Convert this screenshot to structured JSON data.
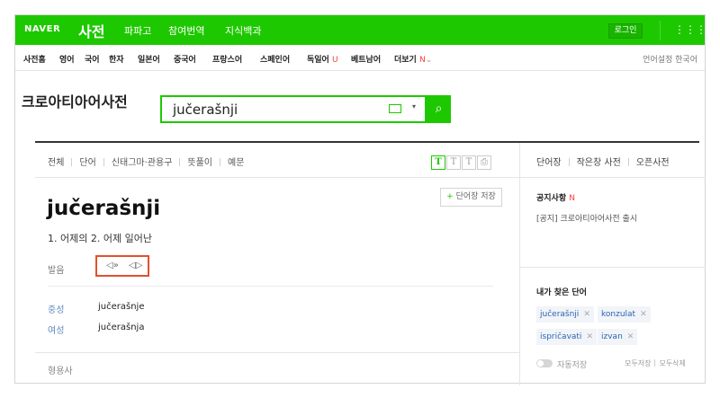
{
  "gnb": {
    "logo": "NAVER",
    "service": "사전",
    "menu": [
      "파파고",
      "참여번역",
      "지식백과"
    ],
    "login": "로그인",
    "grid_icon": "⋮⋮⋮"
  },
  "langs": {
    "items": [
      "사전홈",
      "영어",
      "국어",
      "한자",
      "일본어",
      "중국어",
      "프랑스어",
      "스페인어",
      "독일어",
      "베트남어",
      "더보기"
    ],
    "new_marks": {
      "u": "U",
      "n": "N"
    },
    "more_arrow": "⌄",
    "setting": "언어설정 한국어"
  },
  "dict_title": "크로아티아어사전",
  "search": {
    "value": "jučerašnji",
    "arrow": "▾",
    "button": "⌕"
  },
  "tabs": [
    "전체",
    "단어",
    "신태그마·관용구",
    "뜻풀이",
    "예문"
  ],
  "text_size_buttons": [
    "T",
    "T",
    "T",
    "⎙"
  ],
  "save_button": {
    "plus": "+",
    "label": "단어장 저장"
  },
  "entry": {
    "word": "jučerašnji",
    "meaning": "1. 어제의 2. 어제 일어난",
    "pron_label": "발음",
    "speaker1": "◁»",
    "speaker2": "◁▷",
    "forms": [
      {
        "label": "중성",
        "value": "jučerašnje"
      },
      {
        "label": "여성",
        "value": "jučerašnja"
      }
    ],
    "pos": "형용사"
  },
  "right_tabs": [
    "단어장",
    "작은창 사전",
    "오픈사전"
  ],
  "notice": {
    "title": "공지사항",
    "new": "N",
    "text": "[공지] 크로아티아어사전 출시"
  },
  "recent": {
    "title": "내가 찾은 단어",
    "words": [
      "jučerašnji",
      "konzulat",
      "ispričavati",
      "izvan"
    ],
    "remove_icon": "✕",
    "autosave": "자동저장",
    "save_all": "모두저장",
    "delete_all": "모두삭제"
  },
  "colors": {
    "accent": "#1ec800",
    "highlight": "#e2502e",
    "link": "#2e64b3"
  }
}
